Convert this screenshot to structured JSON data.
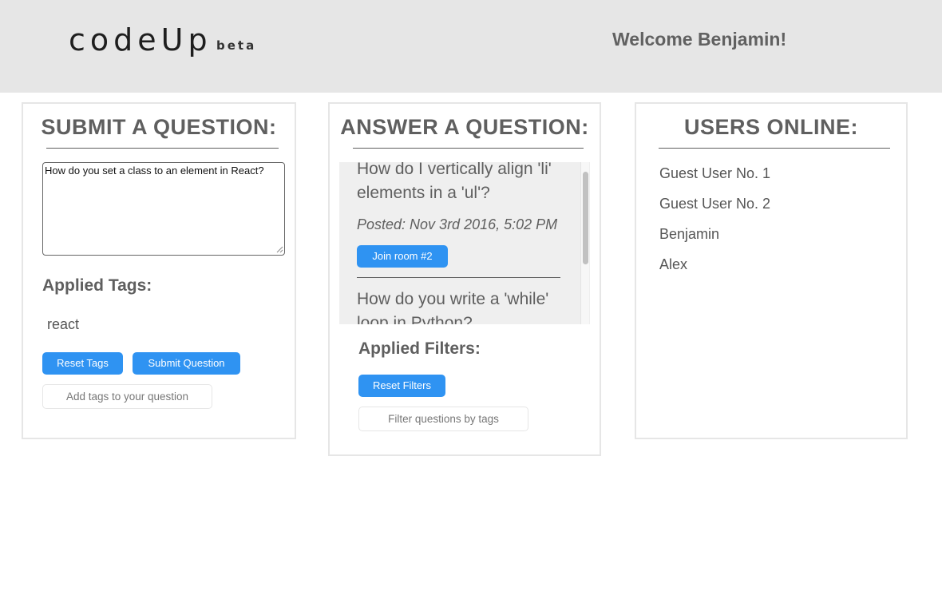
{
  "header": {
    "logo": "codeUp",
    "logo_badge": "beta",
    "welcome": "Welcome Benjamin!"
  },
  "submit_panel": {
    "title": "SUBMIT A QUESTION:",
    "question_value": "How do you set a class to an element in React?",
    "applied_tags_label": "Applied Tags:",
    "tags": [
      "react"
    ],
    "reset_tags_label": "Reset Tags",
    "submit_label": "Submit Question",
    "add_tags_placeholder": "Add tags to your question"
  },
  "answer_panel": {
    "title": "ANSWER A QUESTION:",
    "questions": [
      {
        "title": "How do I vertically align 'li' elements in a 'ul'?",
        "posted": "Posted: Nov 3rd 2016, 5:02 PM",
        "join_label": "Join room #2"
      },
      {
        "title": "How do you write a 'while' loop in Python?"
      }
    ],
    "applied_filters_label": "Applied Filters:",
    "reset_filters_label": "Reset Filters",
    "filter_placeholder": "Filter questions by tags"
  },
  "users_panel": {
    "title": "USERS ONLINE:",
    "users": [
      "Guest User No. 1",
      "Guest User No. 2",
      "Benjamin",
      "Alex"
    ]
  },
  "colors": {
    "accent": "#2f93f2",
    "header_bg": "#e6e6e6",
    "text": "#5f5f5f",
    "question_bg": "#efefef"
  }
}
